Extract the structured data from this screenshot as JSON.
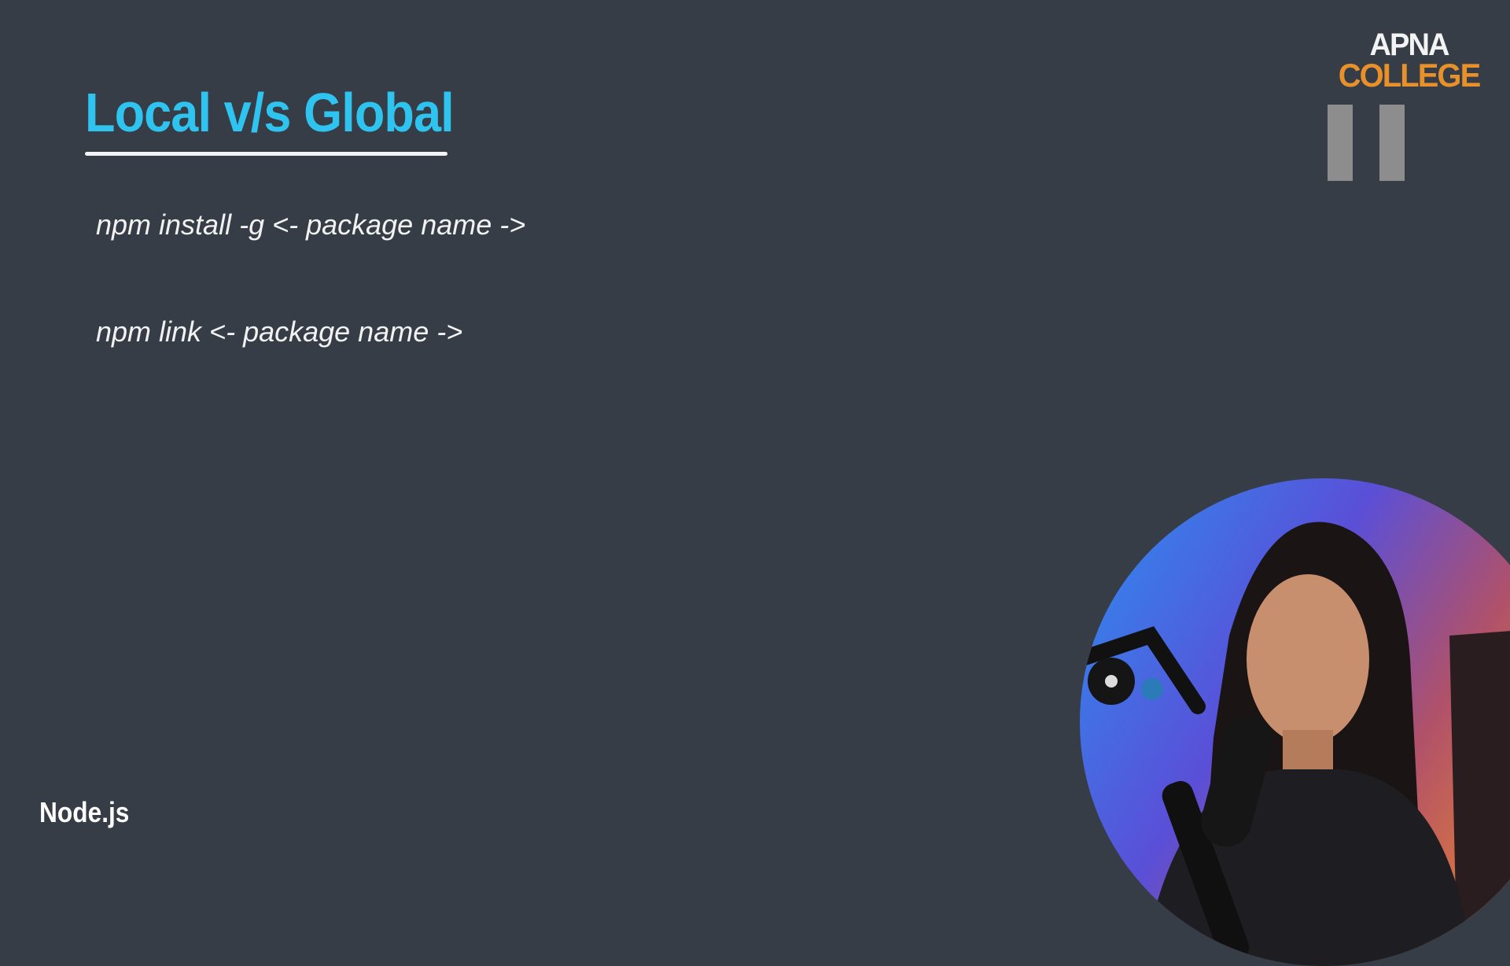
{
  "slide": {
    "title": "Local v/s Global",
    "commands": [
      "npm install -g <- package name ->",
      "npm link <- package name ->"
    ],
    "footer": "Node.js"
  },
  "logo": {
    "line1": "APNA",
    "line2": "COLLEGE"
  },
  "icons": {
    "pause": "pause-icon"
  },
  "colors": {
    "background": "#363d46",
    "title": "#2ec4ef",
    "logo_accent": "#e8912a"
  }
}
